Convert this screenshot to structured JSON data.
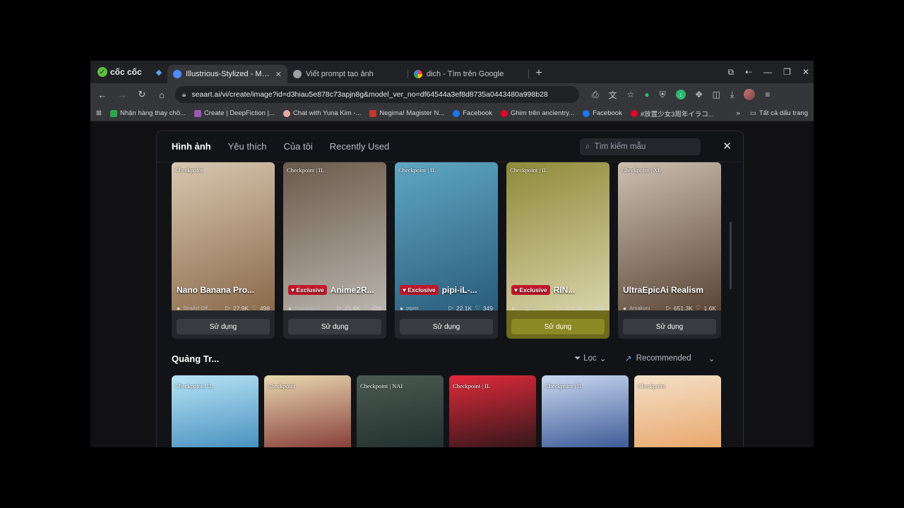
{
  "browser": {
    "brand": "cốc cốc",
    "tabs": [
      {
        "title": "Illustrious-Stylized - Mô Hìn",
        "active": true,
        "favicon_color": "#4f8cff"
      },
      {
        "title": "Viết prompt tạo ảnh",
        "active": false,
        "favicon_color": "#9aa0a6"
      },
      {
        "title": "dich - Tìm trên Google",
        "active": false,
        "favicon_color": "#ea4335"
      }
    ],
    "url": "seaart.ai/vi/create/image?id=d3hiau5e878c73apjn8g&model_ver_no=df64544a3ef8d8735a0443480a998b28",
    "bookmarks": [
      {
        "label": "Nhận hàng thay chồ...",
        "color": "#2aa84a"
      },
      {
        "label": "Create | DeepFiction |...",
        "color": "#9b59b6"
      },
      {
        "label": "Chat with Yuna Kim -...",
        "color": "#e8a9a0"
      },
      {
        "label": "Negima! Magister N...",
        "color": "#c0392b"
      },
      {
        "label": "Facebook",
        "color": "#1877f2"
      },
      {
        "label": "Ghim trên ancientry...",
        "color": "#e60023"
      },
      {
        "label": "Facebook",
        "color": "#1877f2"
      },
      {
        "label": "#放置少女3周年イラコ...",
        "color": "#e60023"
      }
    ],
    "bookmarks_more": "»",
    "all_bookmarks": "Tất cả dấu trang"
  },
  "modal": {
    "tabs": [
      "Hình ảnh",
      "Yêu thích",
      "Của tôi",
      "Recently Used"
    ],
    "search_placeholder": "Tìm kiếm mẫu",
    "cards": [
      {
        "tag": "Checkpoint",
        "title": "Nano Banana Pro...",
        "exclusive": false,
        "author": "SeaArt Off...",
        "runs": "27.9K",
        "likes": "498",
        "use": "Sử dụng",
        "bg": [
          "#8a6a4a",
          "#d9c7b0"
        ]
      },
      {
        "tag": "Checkpoint | IL",
        "title": "Anime2R...",
        "exclusive": true,
        "author": "RiskArt077",
        "runs": "21.6K",
        "likes": "435",
        "use": "Sử dụng",
        "bg": [
          "#b9b4ad",
          "#6b5a4a"
        ]
      },
      {
        "tag": "Checkpoint | IL",
        "title": "pipi-iL-...",
        "exclusive": true,
        "author": "pipiei",
        "runs": "22.1K",
        "likes": "349",
        "use": "Sử dụng",
        "bg": [
          "#2a5c7a",
          "#5fa7c4"
        ]
      },
      {
        "tag": "Checkpoint | IL",
        "title": "RIN...",
        "exclusive": true,
        "author": "Rin_x0",
        "runs": "116.3K",
        "likes": "961",
        "use": "Sử dụng",
        "bg": [
          "#d8d3a8",
          "#8f8a3a"
        ]
      },
      {
        "tag": "Checkpoint | XL",
        "title": "UltraEpicAi Realism",
        "exclusive": false,
        "author": "Amakuni",
        "runs": "651.3K",
        "likes": "1.6K",
        "use": "Sử dụng",
        "bg": [
          "#5a4636",
          "#cdbfb0"
        ]
      }
    ],
    "exclusive_label": "Exclusive",
    "section_title": "Quảng Tr...",
    "filter_label": "Lọc",
    "sort_label": "Recommended",
    "row2": [
      {
        "tag": "Checkpoint | IL",
        "bg": [
          "#3a86b8",
          "#b7e3f5"
        ]
      },
      {
        "tag": "Checkpoint",
        "bg": [
          "#7a2a2a",
          "#e8d8b0"
        ]
      },
      {
        "tag": "Checkpoint | NAI",
        "bg": [
          "#1d2b28",
          "#4a5a52"
        ]
      },
      {
        "tag": "Checkpoint | IL",
        "bg": [
          "#1a1416",
          "#e02a3a"
        ]
      },
      {
        "tag": "Checkpoint | IL",
        "bg": [
          "#2b4a8a",
          "#c9d8f0"
        ]
      },
      {
        "tag": "Checkpoint",
        "bg": [
          "#e8a060",
          "#f3e0c8"
        ]
      }
    ]
  }
}
